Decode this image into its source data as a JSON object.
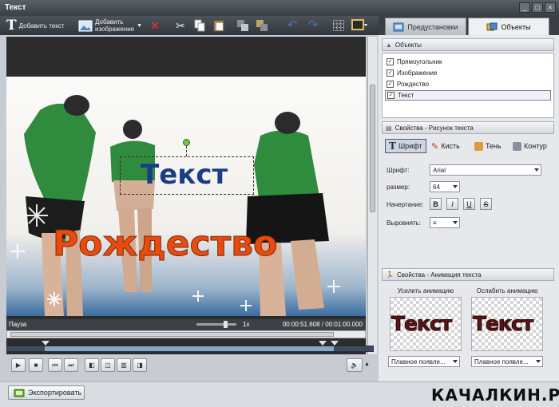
{
  "window": {
    "title": "Текст"
  },
  "toolbar": {
    "add_text": "Добавить текст",
    "add_image_line1": "Добавить",
    "add_image_line2": "изображение"
  },
  "tabs": {
    "presets": "Предустановки",
    "objects": "Объекты"
  },
  "objects_panel": {
    "header": "Объекты",
    "items": [
      {
        "label": "Прямоугольник",
        "checked": true
      },
      {
        "label": "Изображение",
        "checked": true
      },
      {
        "label": "Рождество",
        "checked": true
      },
      {
        "label": "Текст",
        "checked": true,
        "selected": true
      }
    ]
  },
  "stage": {
    "text_main": "Текст",
    "text_secondary": "Рождество"
  },
  "status": {
    "state": "Пауза",
    "zoom": "1x",
    "time_current": "00:00:51.608",
    "time_separator": "/",
    "time_total": "00:01:00.000",
    "playhead_fraction": 0.86
  },
  "properties": {
    "header": "Свойства - Рисунок текста",
    "tabs": [
      "Шрифт",
      "Кисть",
      "Тень",
      "Контур"
    ],
    "font_label": "Шрифт:",
    "font_value": "Arial",
    "size_label": "размер:",
    "size_value": "64",
    "style_label": "Начертание:",
    "style_buttons": [
      "B",
      "I",
      "U",
      "S"
    ],
    "align_label": "Выровнять:",
    "align_symbol": "≡"
  },
  "animation": {
    "header": "Свойства - Анимация текста",
    "enhance_label": "Усилить анимацию",
    "weaken_label": "Ослабить анимацию",
    "preview_text": "Текст",
    "enhance_value": "Плавное появле...",
    "weaken_value": "Плавное появле..."
  },
  "export": {
    "label": "Экспортировать"
  },
  "watermark": {
    "text": "КАЧАЛКИН.РУ"
  },
  "colors": {
    "accent": "#4c5a6c",
    "rozhdestvo": "#e84a10",
    "tekst": "#1b3d86"
  }
}
